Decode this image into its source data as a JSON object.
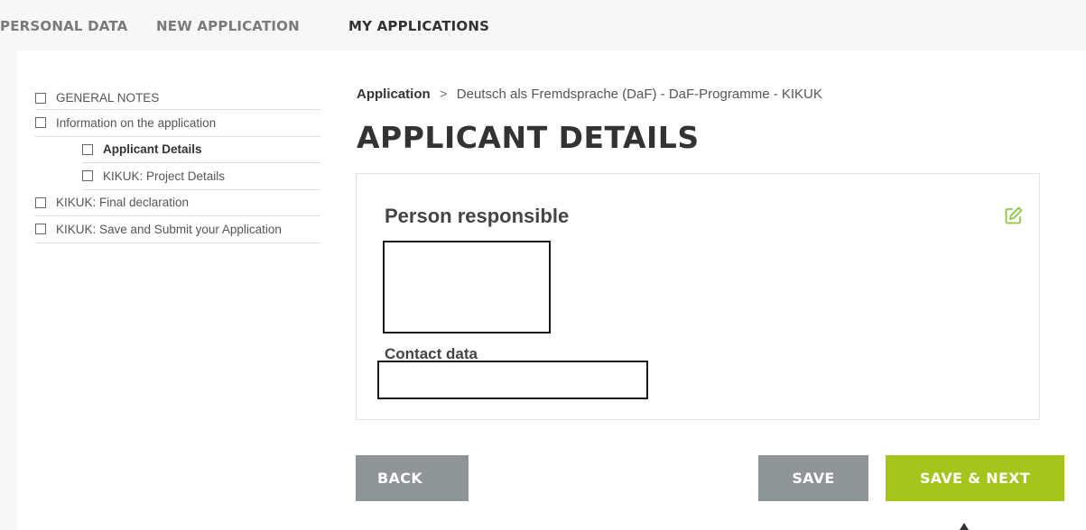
{
  "topnav": {
    "tabs": [
      {
        "label": "PERSONAL DATA"
      },
      {
        "label": "NEW APPLICATION"
      },
      {
        "label": "MY APPLICATIONS"
      }
    ],
    "active_tab": "MY APPLICATIONS"
  },
  "sidebar": {
    "items": [
      {
        "label": "GENERAL NOTES",
        "level": 1
      },
      {
        "label": "Information on the application",
        "level": 1
      },
      {
        "label": "Applicant Details",
        "level": 2,
        "active": true
      },
      {
        "label": "KIKUK: Project Details",
        "level": 2
      },
      {
        "label": "KIKUK: Final declaration",
        "level": 1
      },
      {
        "label": "KIKUK: Save and Submit your Application",
        "level": 1
      }
    ]
  },
  "breadcrumb": {
    "first": "Application",
    "separator": ">",
    "rest": "Deutsch als Fremdsprache (DaF) - DaF-Programme - KIKUK"
  },
  "page": {
    "title": "APPLICANT DETAILS"
  },
  "card": {
    "heading": "Person responsible",
    "contact_label": "Contact data",
    "edit_icon": "edit-icon"
  },
  "buttons": {
    "back": "BACK",
    "save": "SAVE",
    "save_next": "SAVE & NEXT"
  },
  "colors": {
    "accent_green": "#a6c51c",
    "button_gray": "#8f9497",
    "edit_icon_green": "#8cc63f"
  }
}
